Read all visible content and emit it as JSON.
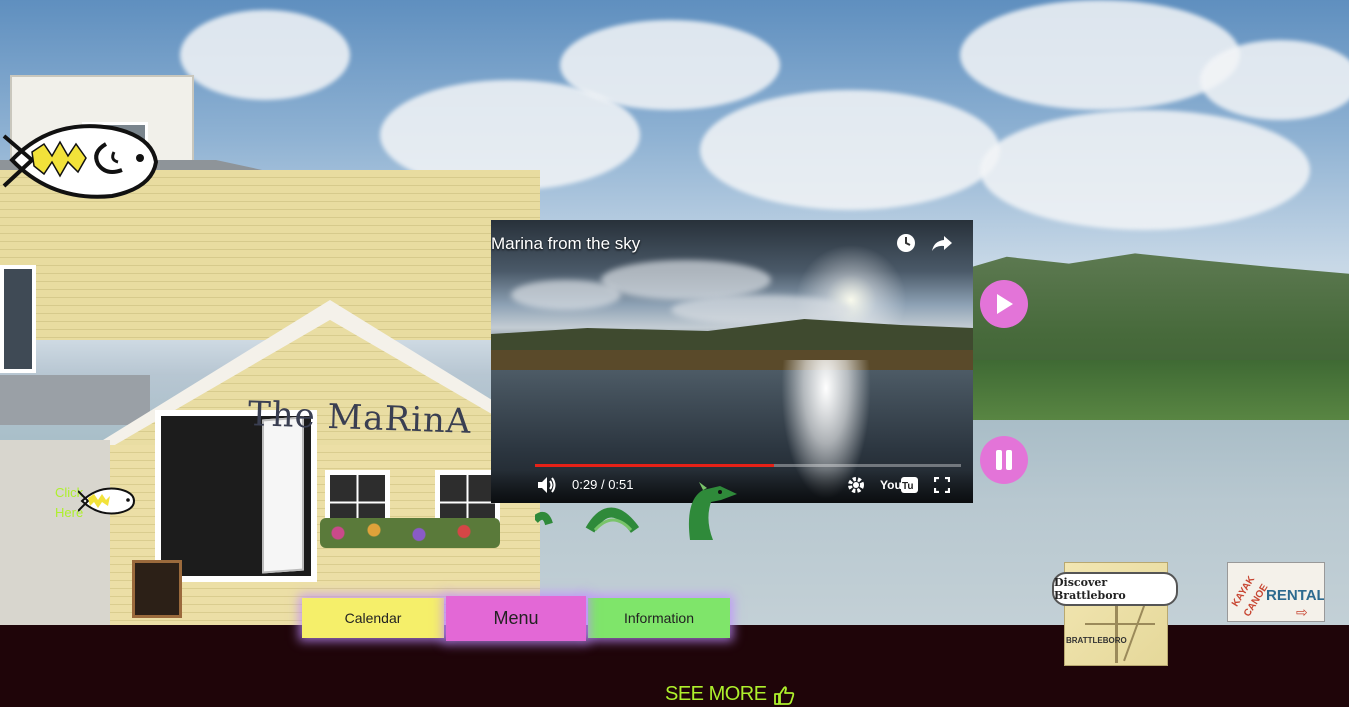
{
  "video": {
    "title": "Marina from the sky",
    "current_time": "0:29",
    "duration": "0:51",
    "separator": "/",
    "progress": 0.56
  },
  "side_controls": {
    "play_icon": "play-icon",
    "pause_icon": "pause-icon"
  },
  "building_sign": "The MaRinA",
  "click_here": {
    "line1": "Click",
    "line2": "Here"
  },
  "nav": {
    "calendar": "Calendar",
    "menu": "Menu",
    "information": "Information"
  },
  "map": {
    "banner": "Discover Brattleboro",
    "town": "BRATTLEBORO"
  },
  "kayak": {
    "line1": "KAYAK",
    "line2": "CANOE",
    "line3": "RENTALS"
  },
  "see_more": "SEE MORE",
  "colors": {
    "accent_green": "#aef02c",
    "pink": "#e374d8",
    "calendar_yellow": "#f5ef6a",
    "info_green": "#7fe56a",
    "footer_bg": "#1f0509"
  }
}
